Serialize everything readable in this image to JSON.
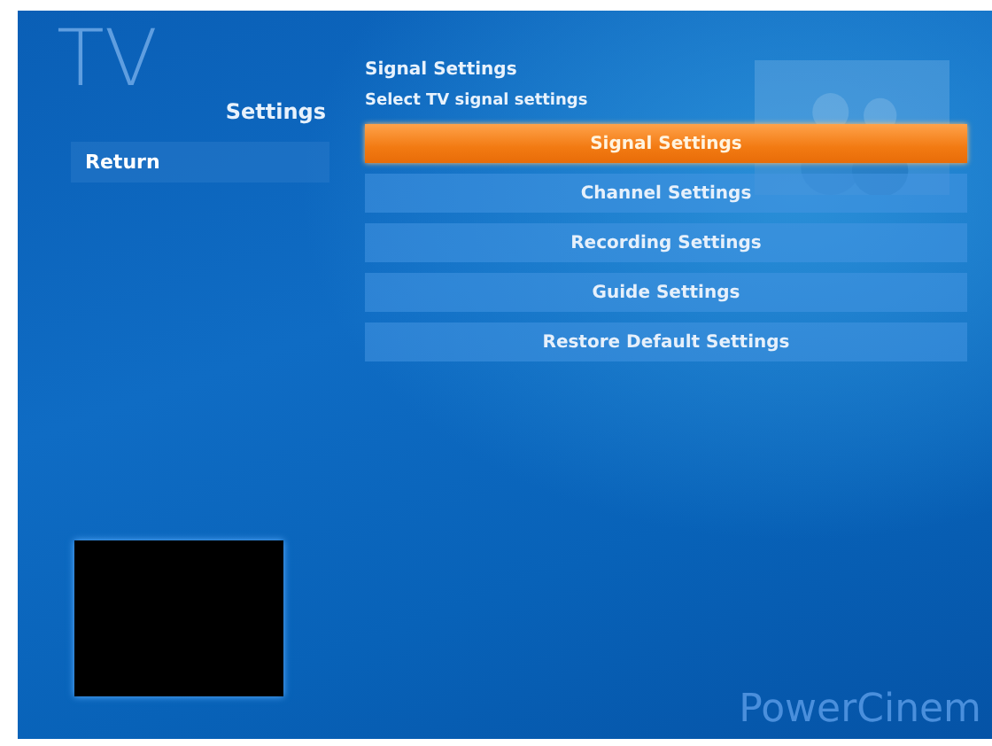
{
  "logo_text": "TV",
  "breadcrumb": "Settings",
  "header": {
    "title": "Signal Settings",
    "subtitle": "Select TV signal settings"
  },
  "side_items": [
    {
      "label": "Return",
      "selected": false
    }
  ],
  "menu": [
    {
      "label": "Signal Settings",
      "selected": true
    },
    {
      "label": "Channel Settings",
      "selected": false
    },
    {
      "label": "Recording Settings",
      "selected": false
    },
    {
      "label": "Guide Settings",
      "selected": false
    },
    {
      "label": "Restore Default Settings",
      "selected": false
    }
  ],
  "preview": {
    "kind": "video"
  },
  "brand": "PowerCinem"
}
